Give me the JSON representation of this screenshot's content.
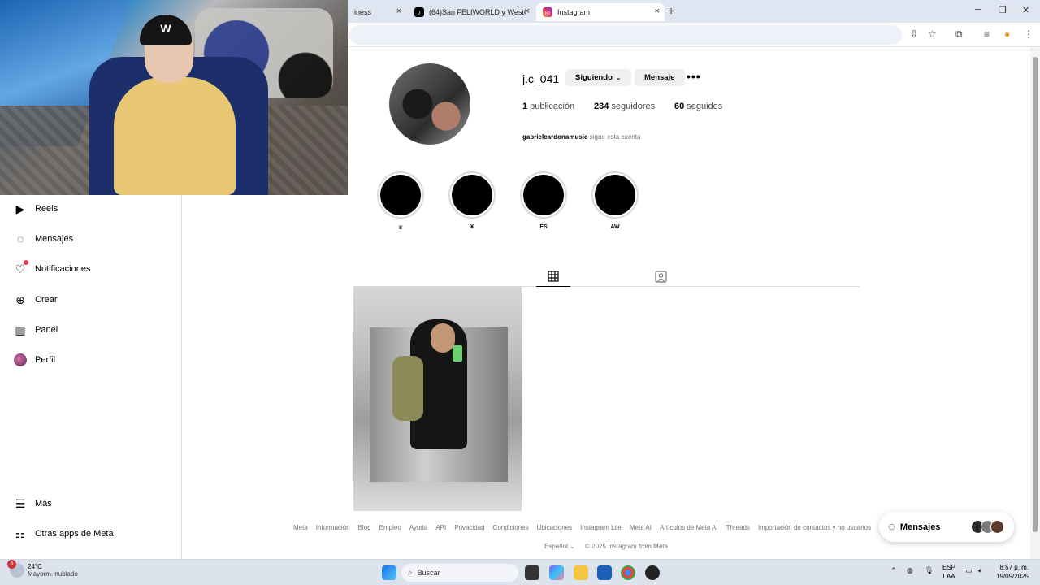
{
  "browser": {
    "tabs": [
      {
        "label": "iness",
        "active": false
      },
      {
        "label": "(64)San FELIWORLD y WestGo...",
        "active": false
      },
      {
        "label": "Instagram",
        "active": true
      }
    ],
    "new_tab": "+",
    "close": "×"
  },
  "sidebar": {
    "items": [
      {
        "label": "Reels",
        "icon": "reels-icon"
      },
      {
        "label": "Mensajes",
        "icon": "messenger-icon"
      },
      {
        "label": "Notificaciones",
        "icon": "heart-icon"
      },
      {
        "label": "Crear",
        "icon": "plus-square-icon"
      },
      {
        "label": "Panel",
        "icon": "chart-icon"
      },
      {
        "label": "Perfil",
        "icon": "avatar"
      }
    ],
    "bottom": [
      {
        "label": "Más",
        "icon": "menu-icon"
      },
      {
        "label": "Otras apps de Meta",
        "icon": "meta-apps-icon"
      }
    ]
  },
  "profile": {
    "username": "j.c_041",
    "following_button": "Siguiendo",
    "message_button": "Mensaje",
    "stats": {
      "posts_count": "1",
      "posts_label": "publicación",
      "followers_count": "234",
      "followers_label": "seguidores",
      "following_count": "60",
      "following_label": "seguidos"
    },
    "followed_by_user": "gabrielcardonamusic",
    "followed_by_text": "sigue esta cuenta"
  },
  "highlights": [
    {
      "label": "♛"
    },
    {
      "label": "¥"
    },
    {
      "label": "ES"
    },
    {
      "label": "AW"
    }
  ],
  "footer": {
    "links": [
      "Meta",
      "Información",
      "Blog",
      "Empleo",
      "Ayuda",
      "API",
      "Privacidad",
      "Condiciones",
      "Ubicaciones",
      "Instagram Lite",
      "Meta AI",
      "Artículos de Meta AI",
      "Threads",
      "Importación de contactos y no usuarios"
    ],
    "language": "Español",
    "copyright": "© 2025 Instagram from Meta"
  },
  "messages_pill": {
    "label": "Mensajes"
  },
  "taskbar": {
    "weather_badge": "6",
    "temperature": "24°C",
    "weather_desc": "Mayorm. nublado",
    "search_placeholder": "Buscar",
    "lang_top": "ESP",
    "lang_bottom": "LAA",
    "time": "8:57 p. m.",
    "date": "19/09/2025"
  },
  "colors": {
    "notification_dot": "#ff3040",
    "button_bg": "#efefef",
    "muted_text": "#737373",
    "taskbar_bg": "#dde3ec"
  }
}
